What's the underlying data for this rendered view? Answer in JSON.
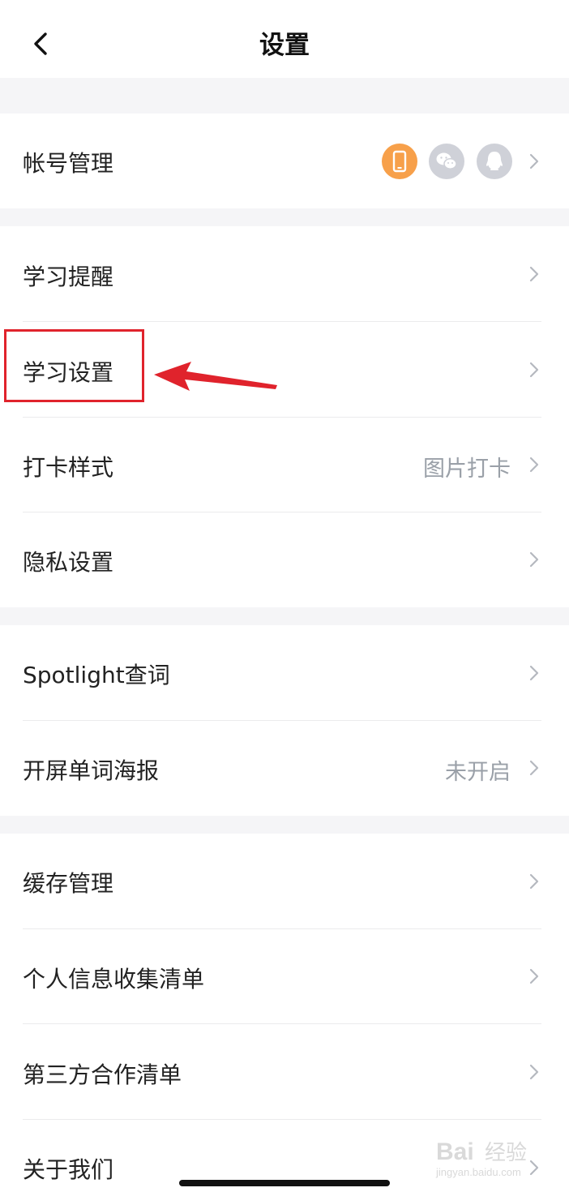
{
  "header": {
    "title": "设置"
  },
  "account": {
    "label": "帐号管理",
    "badges": [
      {
        "icon": "phone-icon",
        "color": "#f7a04a"
      },
      {
        "icon": "wechat-icon",
        "color": "#cfd1d8"
      },
      {
        "icon": "qq-icon",
        "color": "#cfd1d8"
      }
    ]
  },
  "groups": [
    {
      "items": [
        {
          "label": "学习提醒",
          "value": ""
        },
        {
          "label": "学习设置",
          "value": ""
        },
        {
          "label": "打卡样式",
          "value": "图片打卡"
        },
        {
          "label": "隐私设置",
          "value": ""
        }
      ]
    },
    {
      "items": [
        {
          "label": "Spotlight查词",
          "value": ""
        },
        {
          "label": "开屏单词海报",
          "value": "未开启"
        }
      ]
    },
    {
      "items": [
        {
          "label": "缓存管理",
          "value": ""
        },
        {
          "label": "个人信息收集清单",
          "value": ""
        },
        {
          "label": "第三方合作清单",
          "value": ""
        },
        {
          "label": "关于我们",
          "value": ""
        }
      ]
    }
  ],
  "colors": {
    "accent_orange": "#f7a04a",
    "annotation_red": "#e0232c",
    "gap_bg": "#f5f5f7"
  },
  "watermark": {
    "text": "Bai 经验",
    "subtext": "jingyan.baidu.com"
  }
}
